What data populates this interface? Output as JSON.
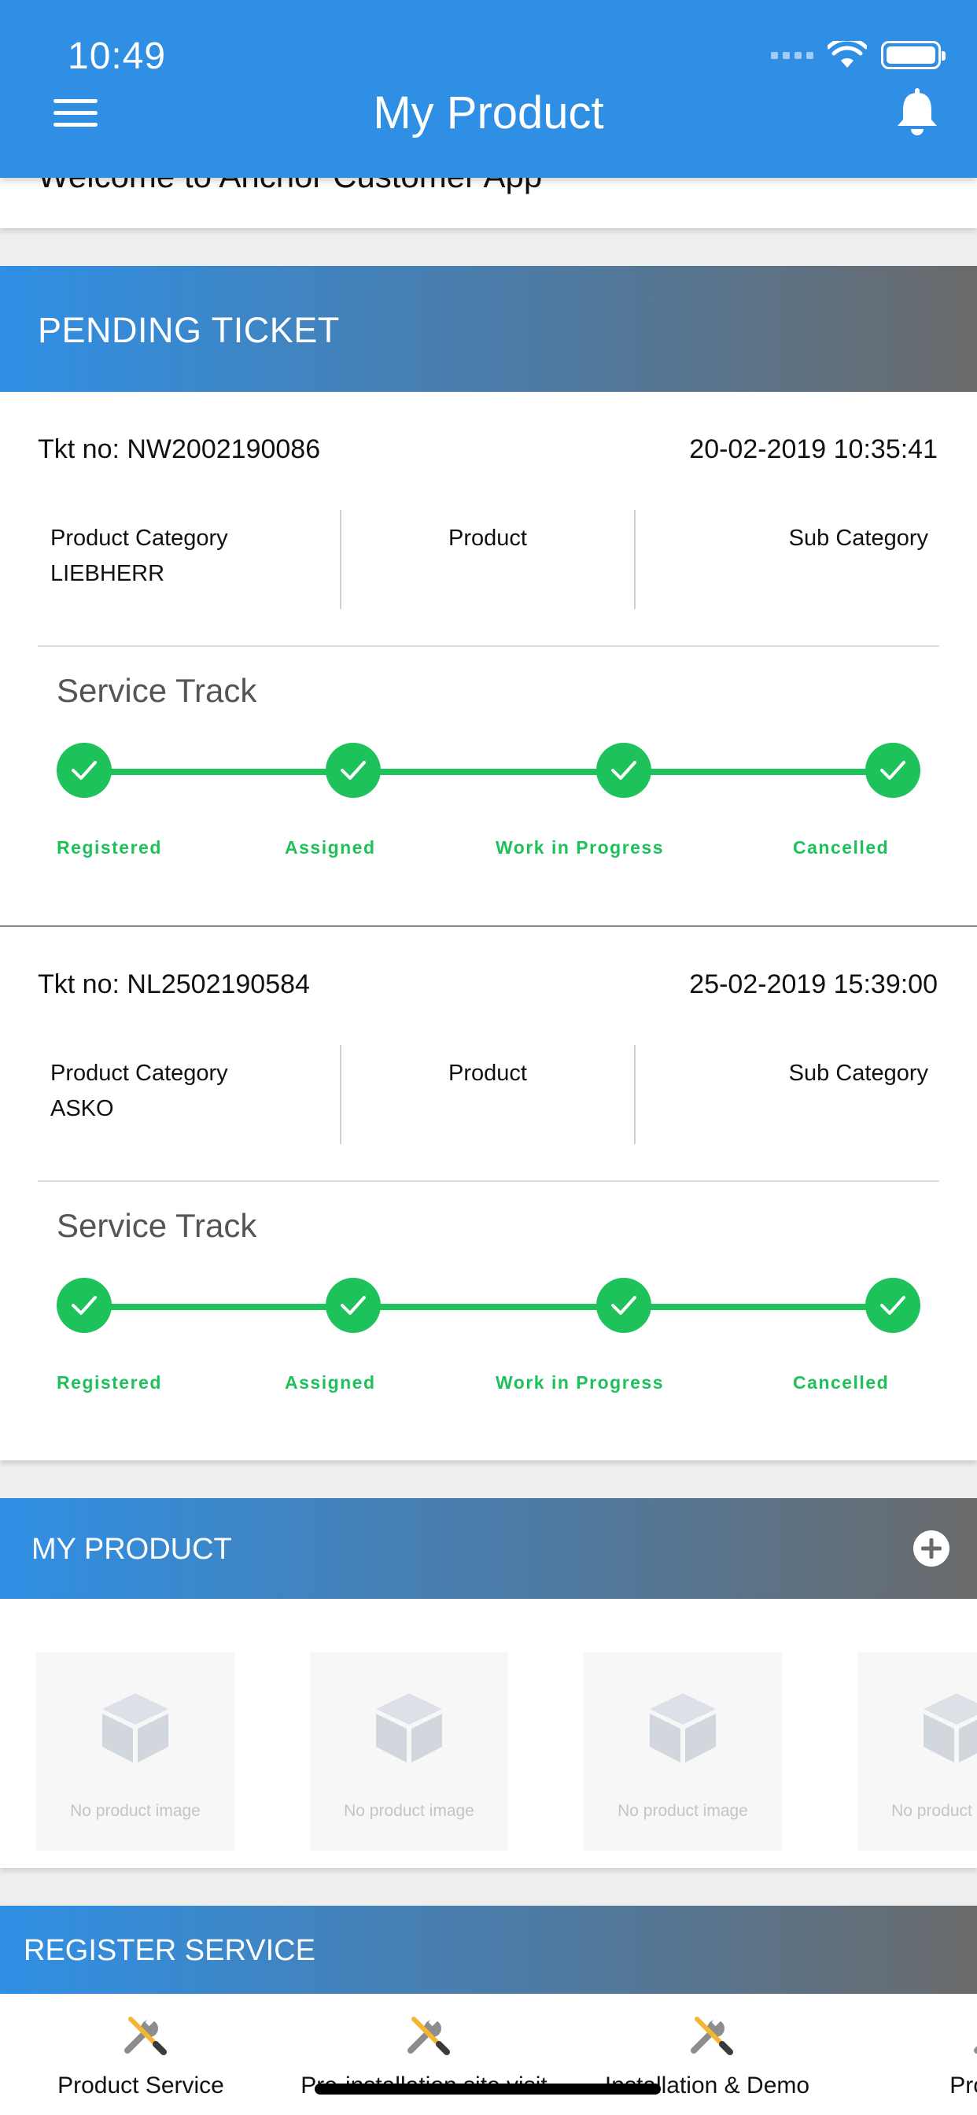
{
  "status_bar": {
    "time": "10:49"
  },
  "header": {
    "title": "My Product"
  },
  "welcome": {
    "text": "Welcome to Anchor Customer App"
  },
  "pending": {
    "title": "PENDING TICKET",
    "tickets": [
      {
        "tkt_no": "Tkt no: NW2002190086",
        "date": "20-02-2019 10:35:41",
        "col1_label": "Product Category",
        "col1_value": "LIEBHERR",
        "col2_label": "Product",
        "col3_label": "Sub Category",
        "track_title": "Service Track",
        "steps": [
          "Registered",
          "Assigned",
          "Work in Progress",
          "Cancelled"
        ]
      },
      {
        "tkt_no": "Tkt no: NL2502190584",
        "date": "25-02-2019 15:39:00",
        "col1_label": "Product Category",
        "col1_value": "ASKO",
        "col2_label": "Product",
        "col3_label": "Sub Category",
        "track_title": "Service Track",
        "steps": [
          "Registered",
          "Assigned",
          "Work in Progress",
          "Cancelled"
        ]
      }
    ]
  },
  "my_product": {
    "title": "MY PRODUCT",
    "items": [
      "No product image",
      "No product image",
      "No product image",
      "No product image"
    ]
  },
  "register_service": {
    "title": "REGISTER SERVICE",
    "tabs": [
      "Product Service",
      "Pre-installation site visit",
      "Installation & Demo",
      "Product"
    ]
  },
  "colors": {
    "header_blue": "#2f8fe4",
    "track_green": "#1ec25a",
    "gradient_end": "#6a6a6a"
  },
  "icons": {
    "menu": "hamburger-menu-icon",
    "bell": "notification-bell-icon",
    "add": "plus-circle-icon",
    "product_placeholder": "cube-icon",
    "service": "wrench-screwdriver-icon",
    "check": "check-icon"
  }
}
